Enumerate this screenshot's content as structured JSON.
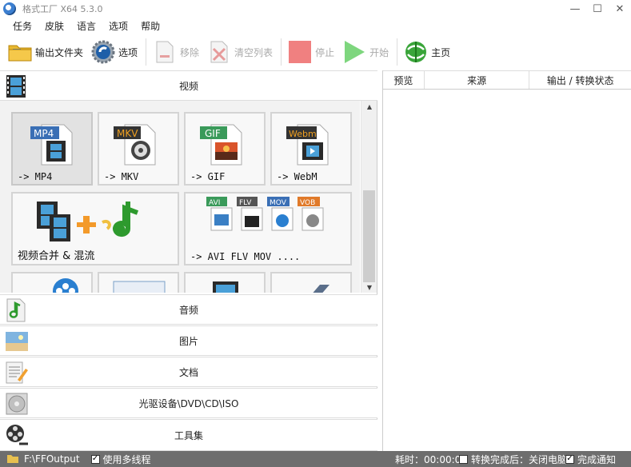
{
  "window": {
    "title": "格式工厂 X64 5.3.0",
    "controls": [
      "—",
      "☐",
      "✕"
    ]
  },
  "menu": [
    "任务",
    "皮肤",
    "语言",
    "选项",
    "帮助"
  ],
  "toolbar": {
    "output_folder": "输出文件夹",
    "options": "选项",
    "remove": "移除",
    "clear_list": "清空列表",
    "stop": "停止",
    "start": "开始",
    "home": "主页"
  },
  "categories": {
    "video": "视频",
    "audio": "音频",
    "image": "图片",
    "document": "文档",
    "disc": "光驱设备\\DVD\\CD\\ISO",
    "tools": "工具集"
  },
  "video_tiles": [
    {
      "badge": "MP4",
      "badge_color": "#3a6fb5",
      "label": "-> MP4"
    },
    {
      "badge": "MKV",
      "badge_color": "#333333",
      "label": "-> MKV"
    },
    {
      "badge": "GIF",
      "badge_color": "#3a9a5a",
      "label": "-> GIF"
    },
    {
      "badge": "Webm",
      "badge_color": "#333333",
      "label": "-> WebM"
    }
  ],
  "merge_tile": {
    "label": "视频合并 & 混流"
  },
  "multi_tile": {
    "label": "-> AVI FLV MOV ....",
    "badges": [
      "AVI",
      "FLV",
      "MOV",
      "VOB"
    ]
  },
  "task_table": {
    "columns": [
      "预览",
      "来源",
      "输出 / 转换状态"
    ]
  },
  "status": {
    "output_path": "F:\\FFOutput",
    "multithread": "使用多线程",
    "elapsed": "耗时：00:00:00",
    "after_done": "转换完成后：关闭电脑",
    "notify": "完成通知",
    "check": "✓"
  },
  "colors": {
    "status_bg": "#6e6e6e",
    "start_green": "#5cc15c",
    "stop_red": "#f08080"
  }
}
